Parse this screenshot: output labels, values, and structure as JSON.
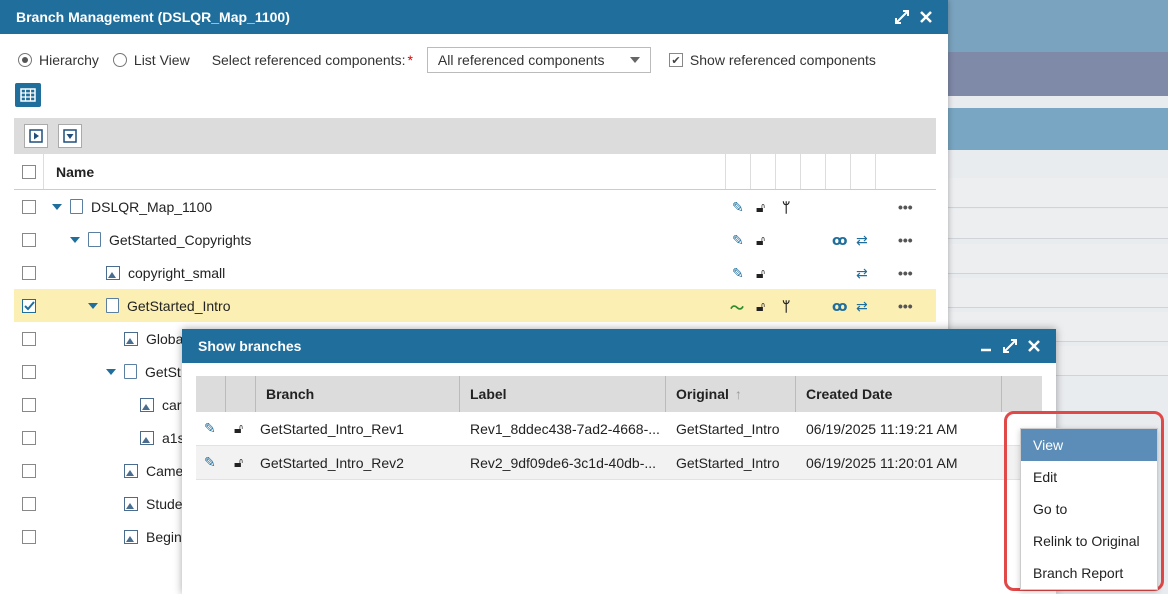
{
  "main_dialog": {
    "title": "Branch Management (DSLQR_Map_1100)",
    "view_options": {
      "hierarchy_label": "Hierarchy",
      "list_view_label": "List View",
      "selected": "Hierarchy"
    },
    "referenced_components": {
      "label": "Select referenced components:",
      "required_mark": "*",
      "selected_value": "All referenced components",
      "show_label": "Show referenced components",
      "show_checked": true
    },
    "tree": {
      "column_name": "Name",
      "rows": [
        {
          "label": "DSLQR_Map_1100",
          "icon": "file-code-icon",
          "expanded": true,
          "checked": false
        },
        {
          "label": "GetStarted_Copyrights",
          "icon": "file-code-icon",
          "expanded": true,
          "checked": false
        },
        {
          "label": "copyright_small",
          "icon": "image-icon",
          "expanded": false,
          "checked": false
        },
        {
          "label": "GetStarted_Intro",
          "icon": "file-code-icon",
          "expanded": true,
          "checked": true,
          "selected": true
        },
        {
          "label": "Globa",
          "icon": "image-icon",
          "expanded": false,
          "checked": false
        },
        {
          "label": "GetSt",
          "icon": "file-code-icon",
          "expanded": true,
          "checked": false
        },
        {
          "label": "car",
          "icon": "image-icon",
          "expanded": false,
          "checked": false
        },
        {
          "label": "a1s",
          "icon": "image-icon",
          "expanded": false,
          "checked": false
        },
        {
          "label": "Came",
          "icon": "image-icon",
          "expanded": false,
          "checked": false
        },
        {
          "label": "Stude",
          "icon": "image-icon",
          "expanded": false,
          "checked": false
        },
        {
          "label": "Begin",
          "icon": "image-icon",
          "expanded": false,
          "checked": false
        }
      ]
    }
  },
  "branches_dialog": {
    "title": "Show branches",
    "columns": [
      "Branch",
      "Label",
      "Original",
      "Created Date"
    ],
    "sort_indicator": "↑",
    "rows": [
      {
        "branch": "GetStarted_Intro_Rev1",
        "label": "Rev1_8ddec438-7ad2-4668-...",
        "original": "GetStarted_Intro",
        "created": "06/19/2025 11:19:21 AM"
      },
      {
        "branch": "GetStarted_Intro_Rev2",
        "label": "Rev2_9df09de6-3c1d-40db-...",
        "original": "GetStarted_Intro",
        "created": "06/19/2025 11:20:01 AM"
      }
    ]
  },
  "context_menu": {
    "items": [
      "View",
      "Edit",
      "Go to",
      "Relink to Original",
      "Branch Report"
    ],
    "active": "View"
  },
  "colors": {
    "titlebar": "#1f6e9b",
    "selected_row": "#fcefb4",
    "menu_active": "#5b8db8",
    "highlight": "#e14848"
  }
}
